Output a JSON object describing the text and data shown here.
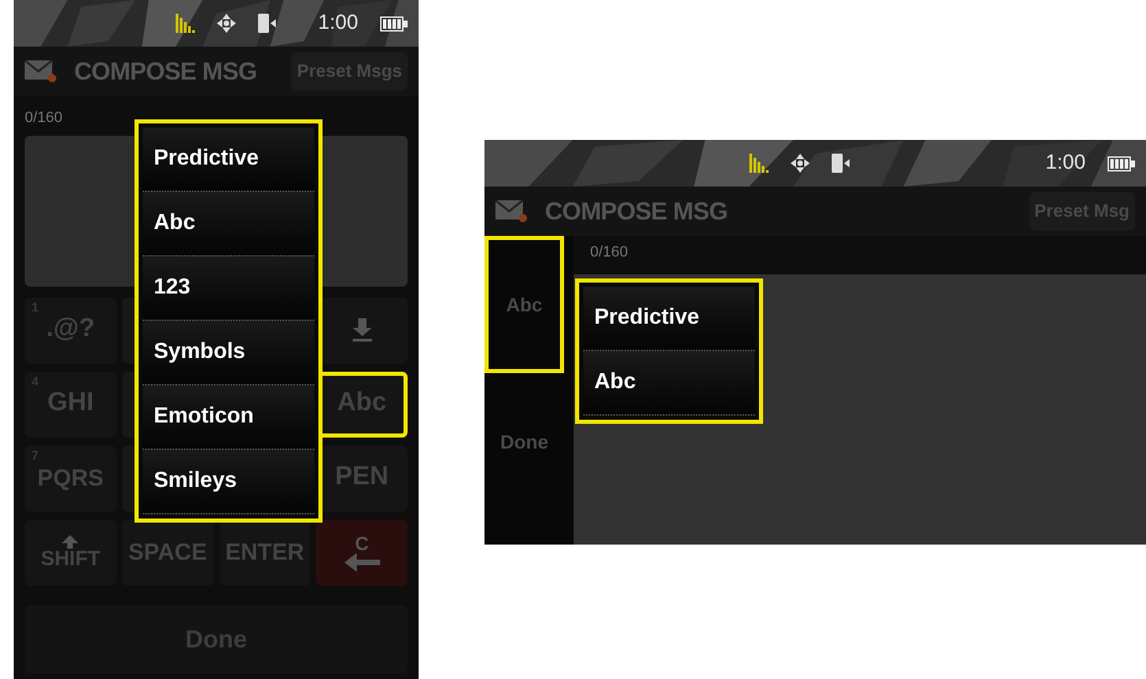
{
  "portrait": {
    "status_bar": {
      "time": "1:00"
    },
    "header": {
      "title": "COMPOSE MSG",
      "button": "Preset Msgs"
    },
    "counter": "0/160",
    "keypad": [
      {
        "kind": "text",
        "digit": "1",
        "label": ".@?",
        "highlighted": false
      },
      {
        "kind": "blank"
      },
      {
        "kind": "covered"
      },
      {
        "kind": "download",
        "highlighted": false
      },
      {
        "kind": "text",
        "digit": "4",
        "label": "GHI",
        "highlighted": false
      },
      {
        "kind": "blank"
      },
      {
        "kind": "covered"
      },
      {
        "kind": "text",
        "label": "Abc",
        "highlighted": true
      },
      {
        "kind": "text",
        "digit": "7",
        "label": "PQRS",
        "highlighted": false
      },
      {
        "kind": "blank"
      },
      {
        "kind": "covered"
      },
      {
        "kind": "text",
        "label": "PEN",
        "highlighted": false
      },
      {
        "kind": "shift",
        "label": "SHIFT",
        "highlighted": false
      },
      {
        "kind": "text",
        "label": "SPACE",
        "highlighted": false
      },
      {
        "kind": "text",
        "label": "ENTER",
        "highlighted": false
      },
      {
        "kind": "backspace",
        "label": "C",
        "highlighted": false
      }
    ],
    "done": "Done",
    "menu": {
      "highlighted": true,
      "items": [
        "Predictive",
        "Abc",
        "123",
        "Symbols",
        "Emoticon",
        "Smileys"
      ]
    }
  },
  "landscape": {
    "status_bar": {
      "time": "1:00"
    },
    "header": {
      "title": "COMPOSE MSG",
      "button": "Preset Msg"
    },
    "counter": "0/160",
    "side_buttons": [
      {
        "label": "Abc",
        "highlighted": true
      },
      {
        "label": "Done",
        "highlighted": false
      }
    ],
    "menu": {
      "highlighted": true,
      "items": [
        "Predictive",
        "Abc"
      ]
    }
  }
}
